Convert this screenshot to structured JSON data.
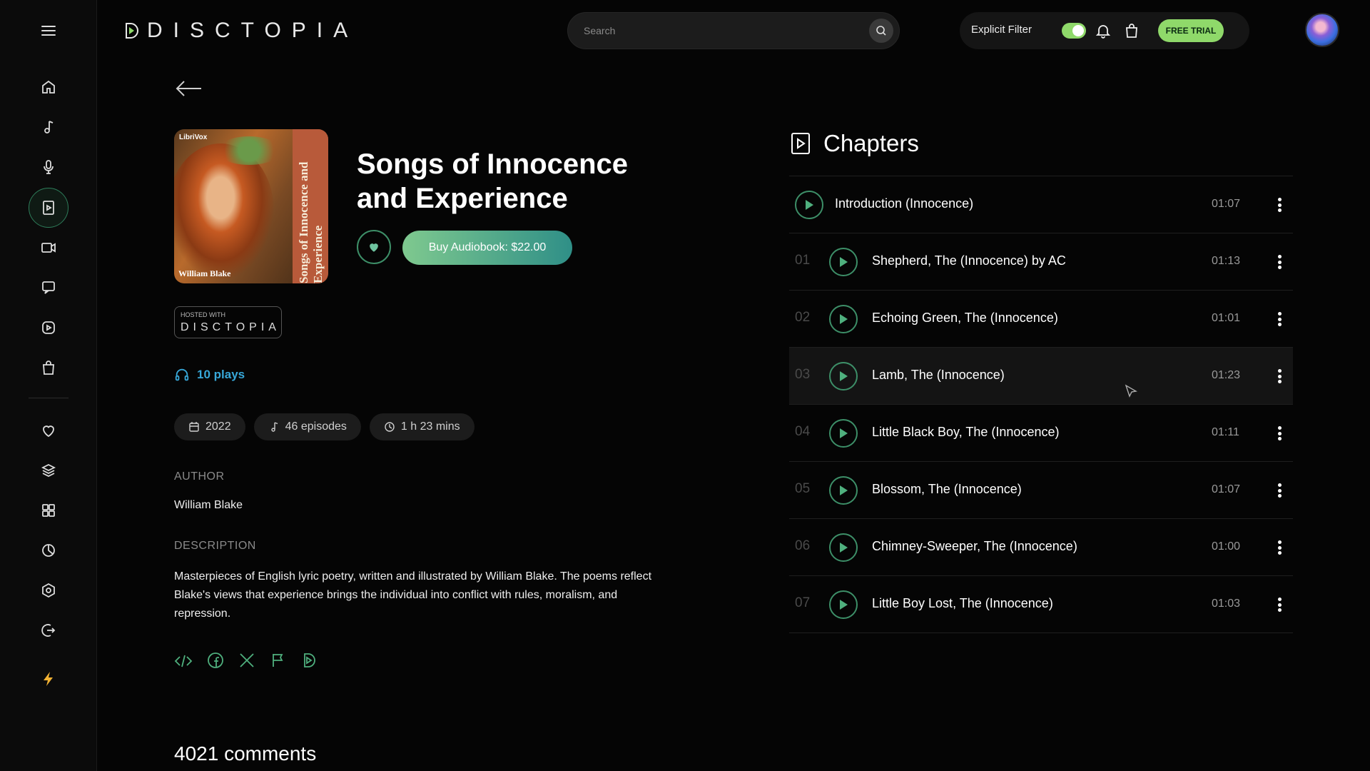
{
  "header": {
    "brand": "DISCTOPIA",
    "search_placeholder": "Search",
    "explicit_filter_label": "Explicit Filter",
    "free_trial_label": "FREE TRIAL"
  },
  "sidebar": {
    "items": [
      {
        "icon": "home-icon"
      },
      {
        "icon": "music-note-icon"
      },
      {
        "icon": "microphone-icon"
      },
      {
        "icon": "audiobook-icon",
        "active": true
      },
      {
        "icon": "video-camera-icon"
      },
      {
        "icon": "chat-icon"
      },
      {
        "icon": "play-circle-icon"
      },
      {
        "icon": "shopping-bag-icon"
      },
      {
        "icon": "heart-icon"
      },
      {
        "icon": "layers-icon"
      },
      {
        "icon": "grid-icon"
      },
      {
        "icon": "pie-chart-icon"
      },
      {
        "icon": "settings-hex-icon"
      },
      {
        "icon": "logout-icon"
      },
      {
        "icon": "lightning-icon"
      }
    ]
  },
  "book": {
    "title": "Songs of Innocence and Experience",
    "cover_publisher": "LibriVox",
    "cover_spine": "Songs of Innocence and Experience",
    "cover_author": "William Blake",
    "buy_label": "Buy Audiobook: $22.00",
    "hosted_with_label": "HOSTED WITH",
    "hosted_brand": "DISCTOPIA",
    "plays": "10 plays",
    "year": "2022",
    "episodes": "46 episodes",
    "duration": "1 h 23 mins",
    "author_label": "AUTHOR",
    "author": "William Blake",
    "description_label": "DESCRIPTION",
    "description": "Masterpieces of English lyric poetry, written and illustrated by William Blake. The poems reflect Blake's views that experience brings the individual into conflict with rules, moralism, and repression.",
    "comments": "4021 comments"
  },
  "chapters": {
    "heading": "Chapters",
    "items": [
      {
        "num": "",
        "title": "Introduction (Innocence)",
        "duration": "01:07"
      },
      {
        "num": "01",
        "title": "Shepherd, The (Innocence) by AC",
        "duration": "01:13"
      },
      {
        "num": "02",
        "title": "Echoing Green, The (Innocence)",
        "duration": "01:01"
      },
      {
        "num": "03",
        "title": "Lamb, The (Innocence)",
        "duration": "01:23",
        "highlighted": true
      },
      {
        "num": "04",
        "title": "Little Black Boy, The (Innocence)",
        "duration": "01:11"
      },
      {
        "num": "05",
        "title": "Blossom, The (Innocence)",
        "duration": "01:07"
      },
      {
        "num": "06",
        "title": "Chimney-Sweeper, The (Innocence)",
        "duration": "01:00"
      },
      {
        "num": "07",
        "title": "Little Boy Lost, The (Innocence)",
        "duration": "01:03"
      }
    ]
  },
  "colors": {
    "accent_green": "#8fd96a",
    "teal": "#2f8f87",
    "link_blue": "#37a7d8",
    "icon_green": "#4fb07e"
  }
}
